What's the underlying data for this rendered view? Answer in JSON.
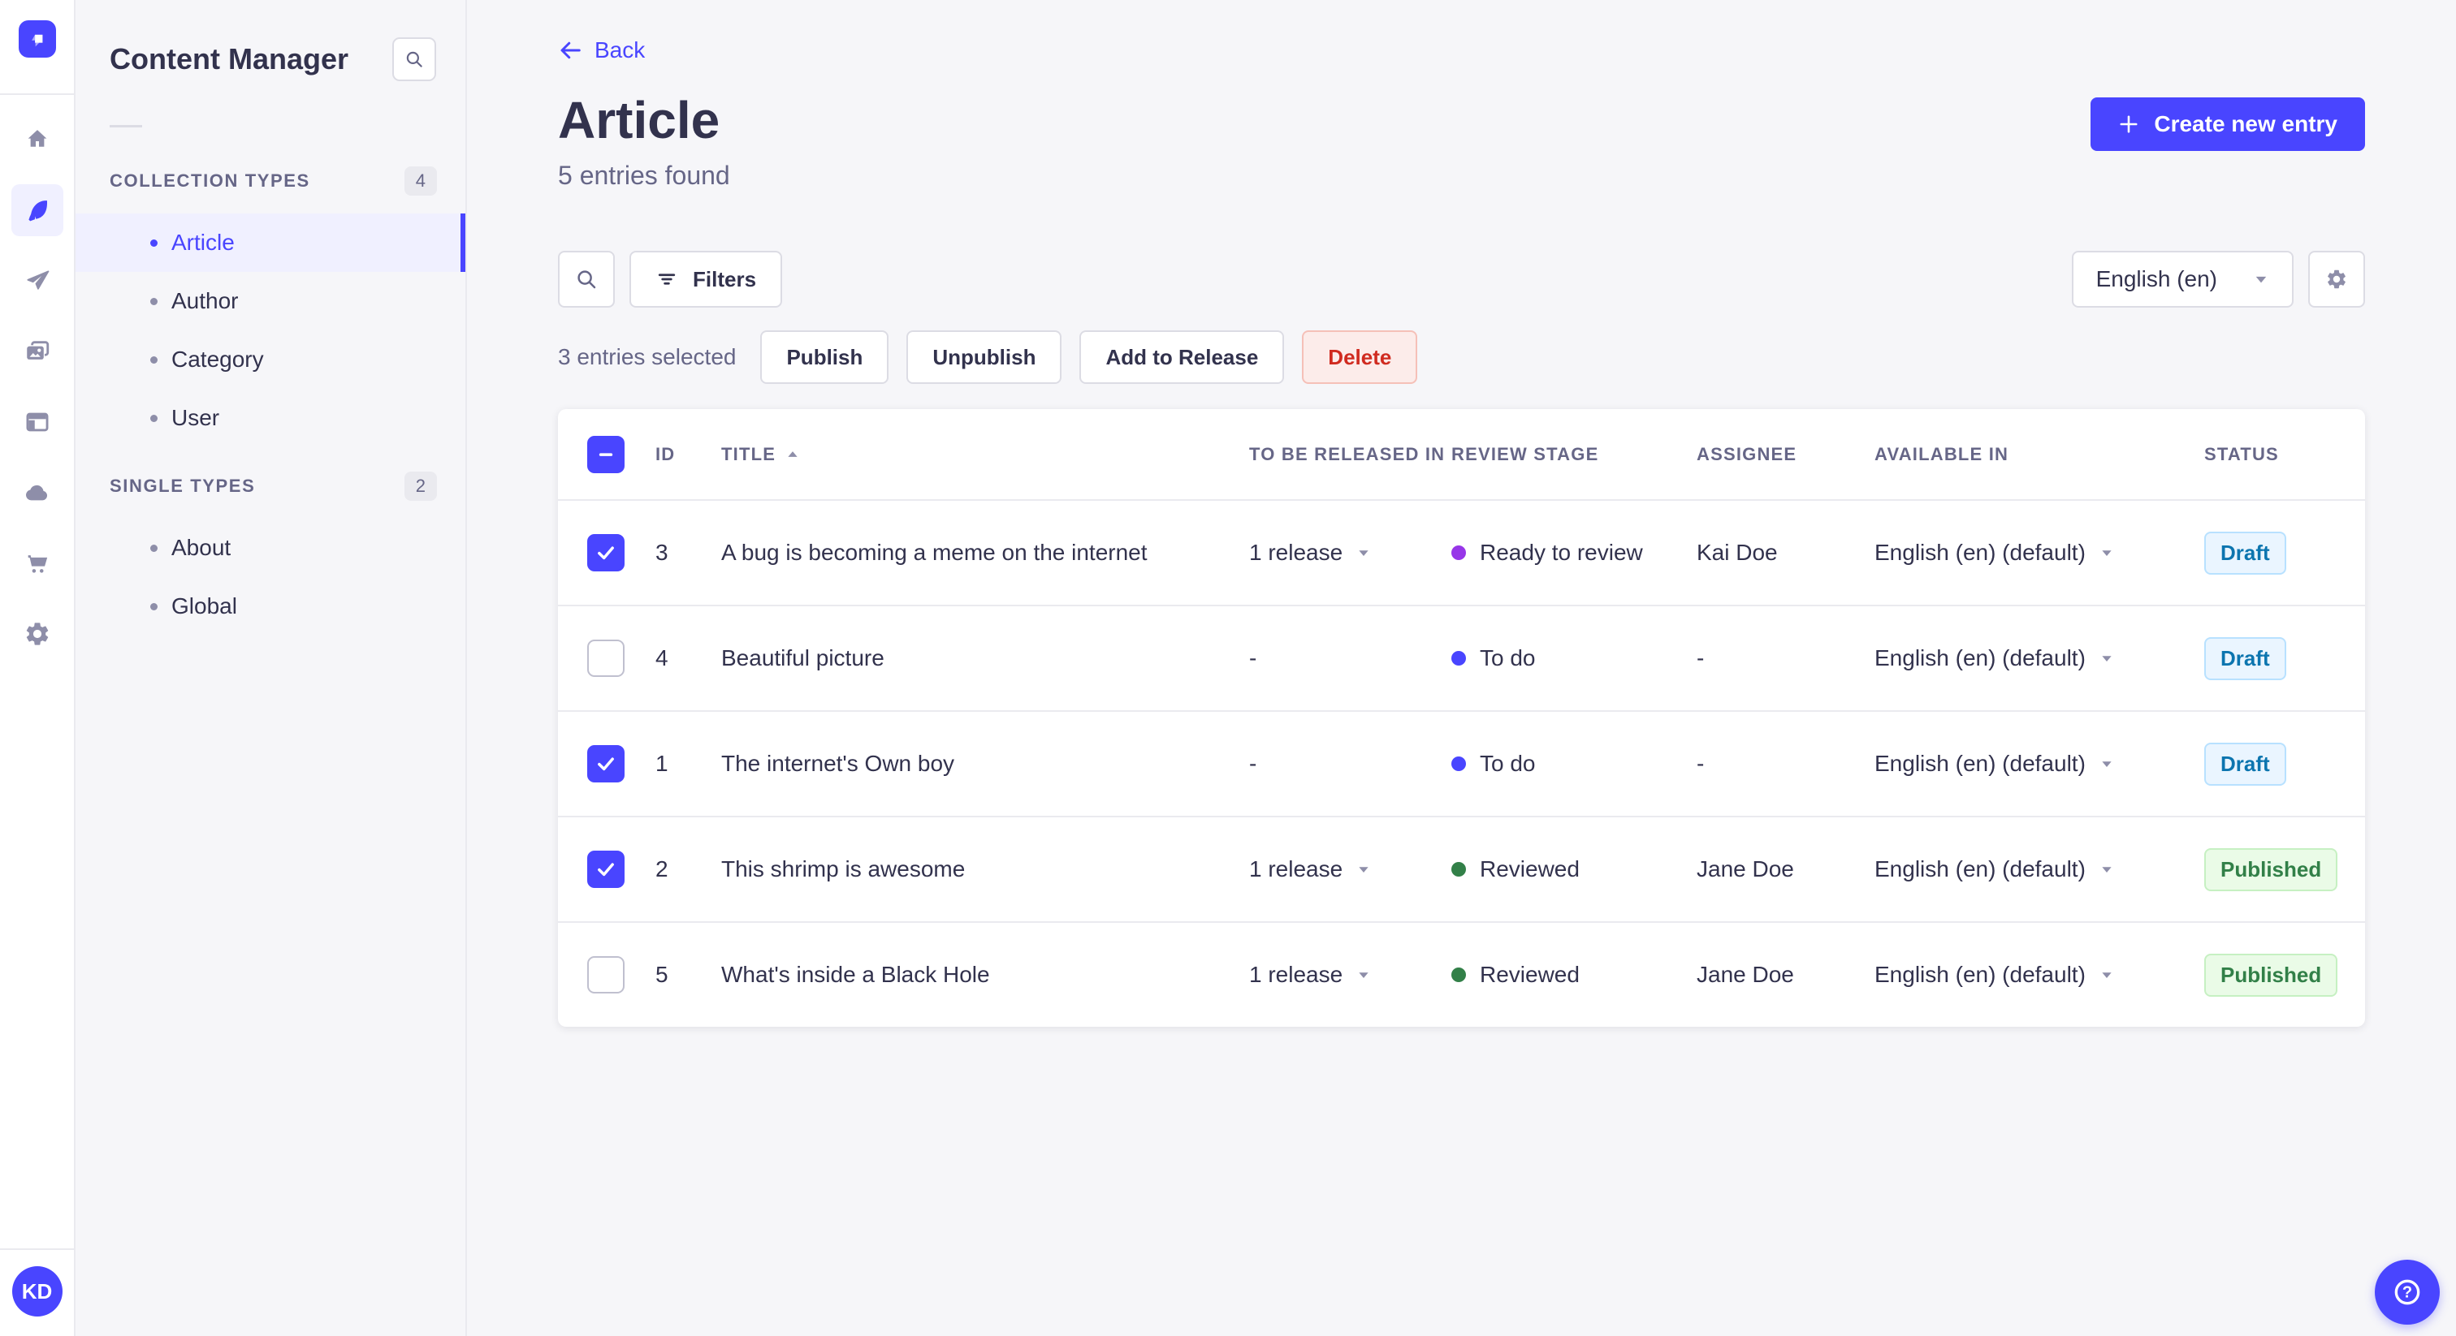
{
  "colors": {
    "primary": "#4945ff",
    "stages": {
      "todo": "#4945ff",
      "ready": "#9736e8",
      "reviewed": "#328048"
    },
    "draft_text": "#0c75af",
    "published_text": "#328048",
    "danger_text": "#d02b20"
  },
  "iconbar": {
    "icons": [
      "home",
      "content-manager",
      "releases",
      "media-library",
      "content-type-builder",
      "deploy",
      "marketplace",
      "settings"
    ],
    "active_icon": "content-manager",
    "user_initials": "KD"
  },
  "subnav": {
    "title": "Content Manager",
    "sections": [
      {
        "label": "COLLECTION TYPES",
        "count": "4",
        "items": [
          "Article",
          "Author",
          "Category",
          "User"
        ],
        "active_item": "Article"
      },
      {
        "label": "SINGLE TYPES",
        "count": "2",
        "items": [
          "About",
          "Global"
        ]
      }
    ]
  },
  "header": {
    "back_label": "Back",
    "title": "Article",
    "subtitle": "5 entries found",
    "create_button_label": "Create new entry"
  },
  "toolbar": {
    "filters_label": "Filters",
    "locale_value": "English (en)"
  },
  "selection": {
    "text": "3 entries selected",
    "publish_label": "Publish",
    "unpublish_label": "Unpublish",
    "add_to_release_label": "Add to Release",
    "delete_label": "Delete"
  },
  "table": {
    "select_all": "indeterminate",
    "headers": {
      "id": "ID",
      "title": "TITLE",
      "release": "TO BE RELEASED IN",
      "review_stage": "REVIEW STAGE",
      "assignee": "ASSIGNEE",
      "available_in": "AVAILABLE IN",
      "status": "STATUS"
    },
    "sort": {
      "column": "title",
      "direction": "asc"
    },
    "rows": [
      {
        "checked": true,
        "id": "3",
        "title": "A bug is becoming a meme on the internet",
        "release": "1 release",
        "stage": "Ready to review",
        "stage_color": "ready",
        "assignee": "Kai Doe",
        "locale": "English (en) (default)",
        "status": "Draft",
        "status_variant": "draft"
      },
      {
        "checked": false,
        "id": "4",
        "title": "Beautiful picture",
        "release": "-",
        "stage": "To do",
        "stage_color": "todo",
        "assignee": "-",
        "locale": "English (en) (default)",
        "status": "Draft",
        "status_variant": "draft"
      },
      {
        "checked": true,
        "id": "1",
        "title": "The internet's Own boy",
        "release": "-",
        "stage": "To do",
        "stage_color": "todo",
        "assignee": "-",
        "locale": "English (en) (default)",
        "status": "Draft",
        "status_variant": "draft"
      },
      {
        "checked": true,
        "id": "2",
        "title": "This shrimp is awesome",
        "release": "1 release",
        "stage": "Reviewed",
        "stage_color": "reviewed",
        "assignee": "Jane Doe",
        "locale": "English (en) (default)",
        "status": "Published",
        "status_variant": "published"
      },
      {
        "checked": false,
        "id": "5",
        "title": "What's inside a Black Hole",
        "release": "1 release",
        "stage": "Reviewed",
        "stage_color": "reviewed",
        "assignee": "Jane Doe",
        "locale": "English (en) (default)",
        "status": "Published",
        "status_variant": "published"
      }
    ]
  },
  "help": {
    "tooltip": "?"
  }
}
